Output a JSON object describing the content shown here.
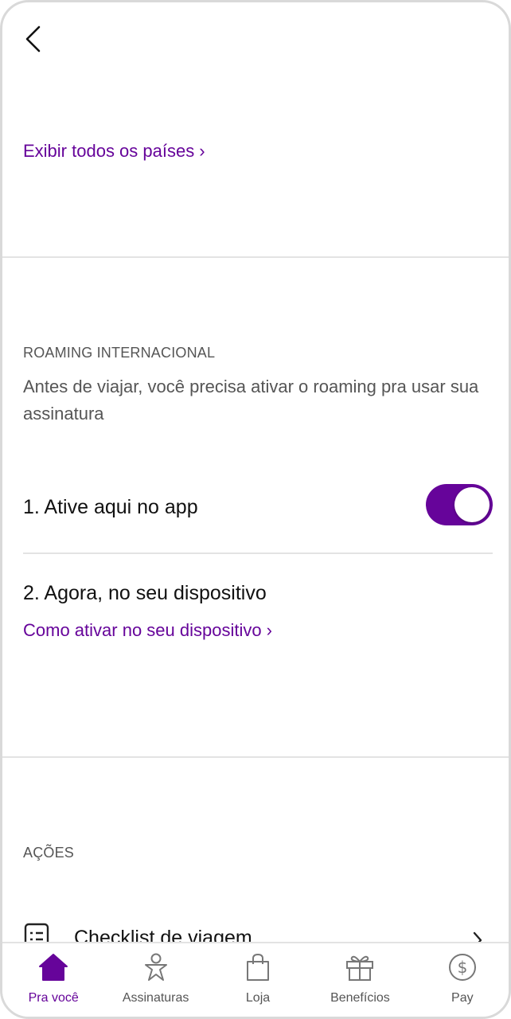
{
  "header": {
    "back_icon": "chevron-left-icon"
  },
  "countries": {
    "link_label": "Exibir todos os países",
    "link_chevron": "›"
  },
  "roaming": {
    "section_label": "ROAMING INTERNACIONAL",
    "description": "Antes de viajar, você precisa ativar o roaming pra usar sua assinatura",
    "step1_label": "1. Ative aqui no app",
    "step1_toggle_on": true,
    "step2_label": "2. Agora, no seu dispositivo",
    "step2_link": "Como ativar no seu dispositivo",
    "step2_chevron": "›"
  },
  "actions": {
    "section_label": "AÇÕES",
    "items": [
      {
        "label": "Checklist de viagem",
        "icon": "checklist-icon"
      }
    ]
  },
  "tabbar": {
    "items": [
      {
        "label": "Pra você",
        "icon": "home-icon",
        "active": true
      },
      {
        "label": "Assinaturas",
        "icon": "person-icon",
        "active": false
      },
      {
        "label": "Loja",
        "icon": "shopping-bag-icon",
        "active": false
      },
      {
        "label": "Benefícios",
        "icon": "gift-icon",
        "active": false
      },
      {
        "label": "Pay",
        "icon": "dollar-circle-icon",
        "active": false
      }
    ]
  },
  "colors": {
    "accent": "#66049a",
    "text_secondary": "#555555",
    "divider": "#e3e3e3"
  }
}
